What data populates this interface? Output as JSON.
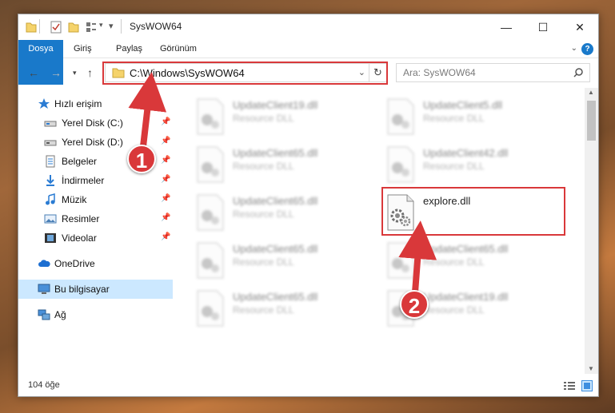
{
  "window": {
    "title": "SysWOW64",
    "minimize": "—",
    "maximize": "☐",
    "close": "✕"
  },
  "ribbon": {
    "tabs": [
      "Dosya",
      "Giriş",
      "Paylaş",
      "Görünüm"
    ],
    "help": "?"
  },
  "nav": {
    "address": "C:\\Windows\\SysWOW64",
    "search_placeholder": "Ara: SysWOW64"
  },
  "sidebar": {
    "items": [
      {
        "label": "Hızlı erişim",
        "icon": "star-icon"
      },
      {
        "label": "Yerel Disk (C:)",
        "icon": "drive-icon"
      },
      {
        "label": "Yerel Disk (D:)",
        "icon": "drive-icon"
      },
      {
        "label": "Belgeler",
        "icon": "documents-icon"
      },
      {
        "label": "İndirmeler",
        "icon": "download-icon"
      },
      {
        "label": "Müzik",
        "icon": "music-icon"
      },
      {
        "label": "Resimler",
        "icon": "pictures-icon"
      },
      {
        "label": "Videolar",
        "icon": "videos-icon"
      },
      {
        "label": "OneDrive",
        "icon": "cloud-icon"
      },
      {
        "label": "Bu bilgisayar",
        "icon": "computer-icon"
      },
      {
        "label": "Ağ",
        "icon": "network-icon"
      }
    ]
  },
  "files": [
    {
      "name": "UpdateClient19.dll",
      "type": "Resource DLL"
    },
    {
      "name": "UpdateClient5.dll",
      "type": "Resource DLL"
    },
    {
      "name": "UpdateClient65.dll",
      "type": "Resource DLL"
    },
    {
      "name": "UpdateClient42.dll",
      "type": "Resource DLL"
    },
    {
      "name": "UpdateClient65.dll",
      "type": "Resource DLL"
    },
    {
      "name": "explore.dll",
      "type": ""
    },
    {
      "name": "UpdateClient65.dll",
      "type": "Resource DLL"
    },
    {
      "name": "UpdateClient65.dll",
      "type": "Resource DLL"
    },
    {
      "name": "UpdateClient65.dll",
      "type": "Resource DLL"
    },
    {
      "name": "UpdateClient19.dll",
      "type": "Resource DLL"
    }
  ],
  "status": {
    "count": "104 öğe"
  },
  "callouts": [
    "1",
    "2"
  ],
  "colors": {
    "accent": "#1979ca",
    "highlight": "#d9383a",
    "selected": "#cce8ff"
  }
}
